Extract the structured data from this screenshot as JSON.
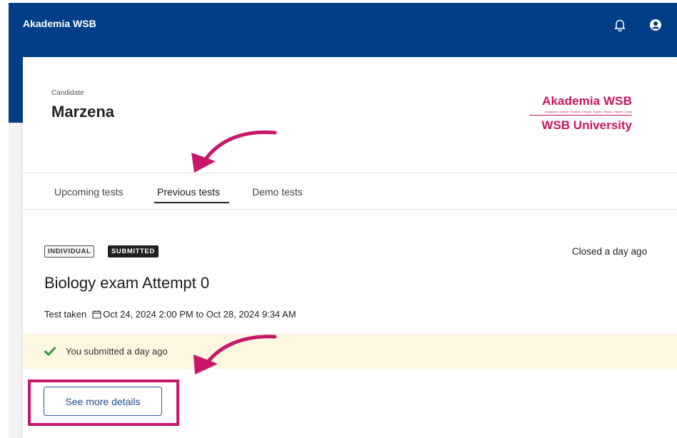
{
  "header": {
    "app_title": "Akademia WSB",
    "icons": [
      "bell-icon",
      "account-circle-icon"
    ]
  },
  "candidate": {
    "label": "Candidate",
    "name": "Marzena"
  },
  "logo": {
    "top": "Akademia WSB",
    "subline": "Bydgoszcz Gliwice, Kraków, Cieszyn, Żywiec, Olkusz, Gliwice, Tychy",
    "bottom": "WSB University"
  },
  "tabs": [
    {
      "label": "Upcoming tests",
      "active": false
    },
    {
      "label": "Previous tests",
      "active": true
    },
    {
      "label": "Demo tests",
      "active": false
    }
  ],
  "test": {
    "badges": [
      "INDIVIDUAL",
      "SUBMITTED"
    ],
    "closed_text": "Closed a day ago",
    "title": "Biology exam Attempt 0",
    "taken_label": "Test taken",
    "taken_range": "Oct 24, 2024 2:00 PM to Oct 28, 2024 9:34 AM",
    "submitted_text": "You submitted a day ago",
    "details_button": "See more details"
  },
  "colors": {
    "header_blue": "#003f87",
    "brand_magenta": "#c8175f",
    "banner_cream": "#fdf6e1",
    "success_green": "#2e9a3e",
    "button_blue": "#1d4f91"
  }
}
